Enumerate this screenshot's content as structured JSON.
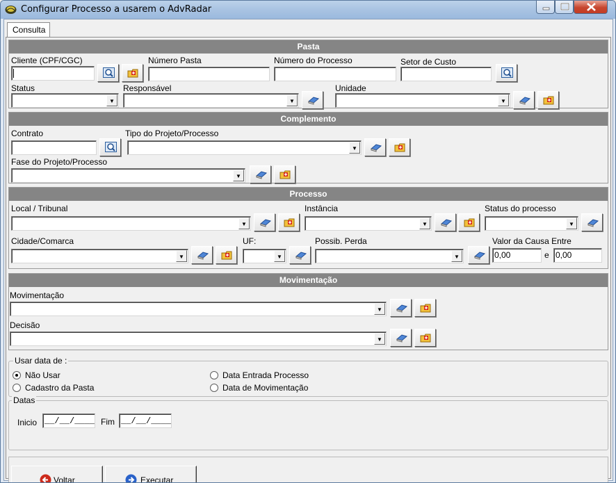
{
  "window": {
    "title": "Configurar Processo a usarem o AdvRadar"
  },
  "tabs": [
    {
      "label": "Consulta"
    }
  ],
  "sections": {
    "pasta": {
      "title": "Pasta",
      "cliente_label": "Cliente (CPF/CGC)",
      "numero_pasta_label": "Número Pasta",
      "numero_processo_label": "Número do Processo",
      "setor_custo_label": "Setor de Custo",
      "status_label": "Status",
      "responsavel_label": "Responsável",
      "unidade_label": "Unidade"
    },
    "complemento": {
      "title": "Complemento",
      "contrato_label": "Contrato",
      "tipo_projeto_label": "Tipo do Projeto/Processo",
      "fase_projeto_label": "Fase do Projeto/Processo"
    },
    "processo": {
      "title": "Processo",
      "local_tribunal_label": "Local / Tribunal",
      "instancia_label": "Instância",
      "status_processo_label": "Status do processo",
      "cidade_comarca_label": "Cidade/Comarca",
      "uf_label": "UF:",
      "possib_perda_label": "Possib. Perda",
      "valor_causa_label": "Valor da Causa Entre",
      "valor_min": "0,00",
      "valor_conj": "e",
      "valor_max": "0,00"
    },
    "movimentacao": {
      "title": "Movimentação",
      "movimentacao_label": "Movimentação",
      "decisao_label": "Decisão"
    }
  },
  "usar_data": {
    "title": "Usar data de :",
    "options": [
      {
        "label": "Não Usar",
        "selected": true
      },
      {
        "label": "Cadastro da Pasta",
        "selected": false
      },
      {
        "label": "Data Entrada Processo",
        "selected": false
      },
      {
        "label": "Data de Movimentação",
        "selected": false
      }
    ]
  },
  "datas": {
    "title": "Datas",
    "inicio_label": "Inicio",
    "inicio_value": "__/__/____",
    "fim_label": "Fim",
    "fim_value": "__/__/____"
  },
  "buttons": {
    "voltar": "Voltar",
    "executar": "Executar"
  },
  "icons": {
    "search": "magnifier-search-icon",
    "folder": "folder-add-icon",
    "eraser": "eraser-clear-icon",
    "back": "back-arrow-icon",
    "forward": "forward-arrow-icon"
  },
  "colors": {
    "section_header": "#858585",
    "voltar_icon": "#cc2a1b",
    "executar_icon": "#2a62c9"
  }
}
